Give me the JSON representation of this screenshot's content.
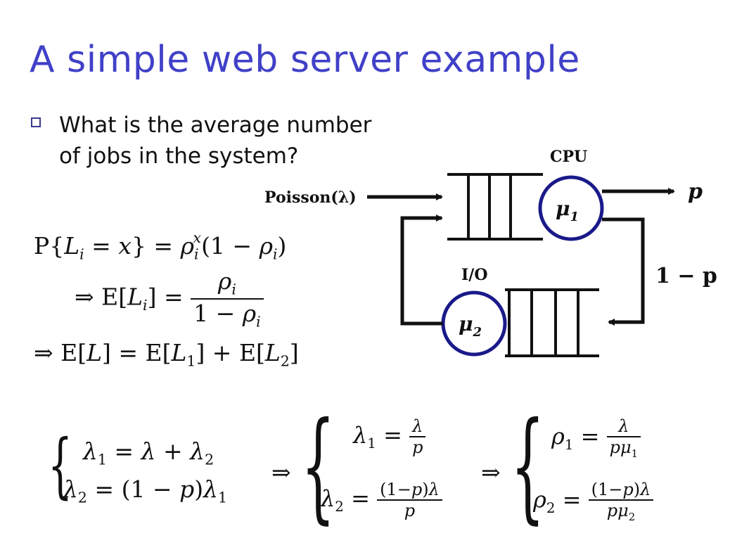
{
  "title": "A simple web server example",
  "question": {
    "line1": "What is the average number",
    "line2": "of jobs in the system?"
  },
  "diagram": {
    "cpu_label": "CPU",
    "io_label": "I/O",
    "input_label": "Poisson(λ)",
    "mu1": "μ",
    "mu1_sub": "1",
    "mu2": "μ",
    "mu2_sub": "2",
    "exit_prob": "p",
    "loop_prob": "1 − p"
  },
  "colors": {
    "title": "#4040c8",
    "server_circle": "#1a1a8a",
    "text": "#111111"
  }
}
